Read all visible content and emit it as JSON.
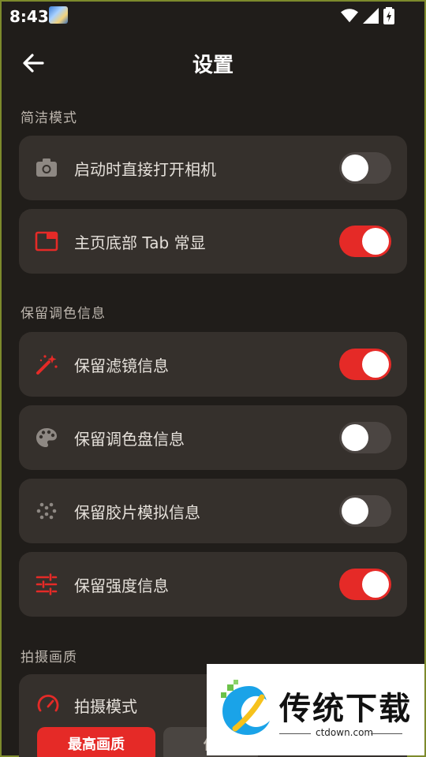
{
  "status": {
    "time": "8:43"
  },
  "header": {
    "title": "设置"
  },
  "sections": [
    {
      "label": "简洁模式",
      "items": [
        {
          "label": "启动时直接打开相机",
          "icon": "camera-icon",
          "on": false
        },
        {
          "label": "主页底部 Tab 常显",
          "icon": "tab-window-icon",
          "on": true
        }
      ]
    },
    {
      "label": "保留调色信息",
      "items": [
        {
          "label": "保留滤镜信息",
          "icon": "magic-wand-icon",
          "on": true
        },
        {
          "label": "保留调色盘信息",
          "icon": "palette-icon",
          "on": false
        },
        {
          "label": "保留胶片模拟信息",
          "icon": "film-grain-icon",
          "on": false
        },
        {
          "label": "保留强度信息",
          "icon": "sliders-icon",
          "on": true
        }
      ]
    },
    {
      "label": "拍摄画质",
      "mode": {
        "label": "拍摄模式",
        "icon": "speedometer-icon",
        "options": [
          "最高画质",
          "低"
        ],
        "selected": "最高画质"
      }
    }
  ],
  "watermark": {
    "brand": "传统下载",
    "url": "ctdown.com"
  },
  "colors": {
    "accent": "#e52a27",
    "card": "#35302c",
    "background": "#201d1a"
  }
}
